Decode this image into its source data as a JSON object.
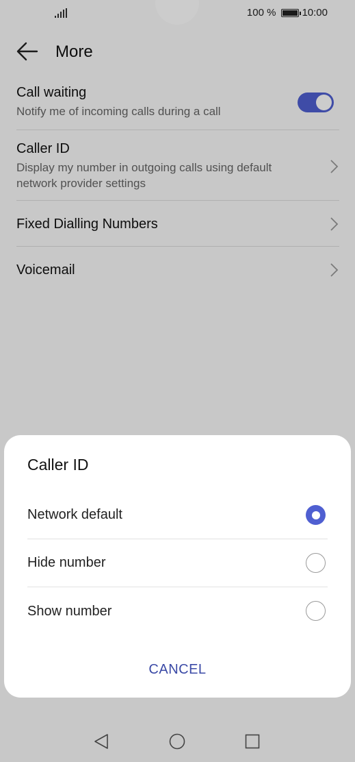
{
  "status_bar": {
    "battery": "100 %",
    "time": "10:00"
  },
  "header": {
    "title": "More"
  },
  "settings": {
    "call_waiting": {
      "title": "Call waiting",
      "subtitle": "Notify me of incoming calls during a call",
      "enabled": true
    },
    "caller_id": {
      "title": "Caller ID",
      "subtitle": "Display my number in outgoing calls using default network provider settings"
    },
    "fdn": {
      "title": "Fixed Dialling Numbers"
    },
    "voicemail": {
      "title": "Voicemail"
    }
  },
  "dialog": {
    "title": "Caller ID",
    "options": [
      {
        "label": "Network default",
        "selected": true
      },
      {
        "label": "Hide number",
        "selected": false
      },
      {
        "label": "Show number",
        "selected": false
      }
    ],
    "cancel_label": "CANCEL"
  },
  "colors": {
    "accent": "#4f5fd1",
    "cancel_text": "#3b4aa6"
  },
  "icons": {
    "back": "arrow-left-icon",
    "chevron": "chevron-right-icon",
    "nav_back": "triangle-back-icon",
    "nav_home": "circle-home-icon",
    "nav_recents": "square-recents-icon"
  }
}
